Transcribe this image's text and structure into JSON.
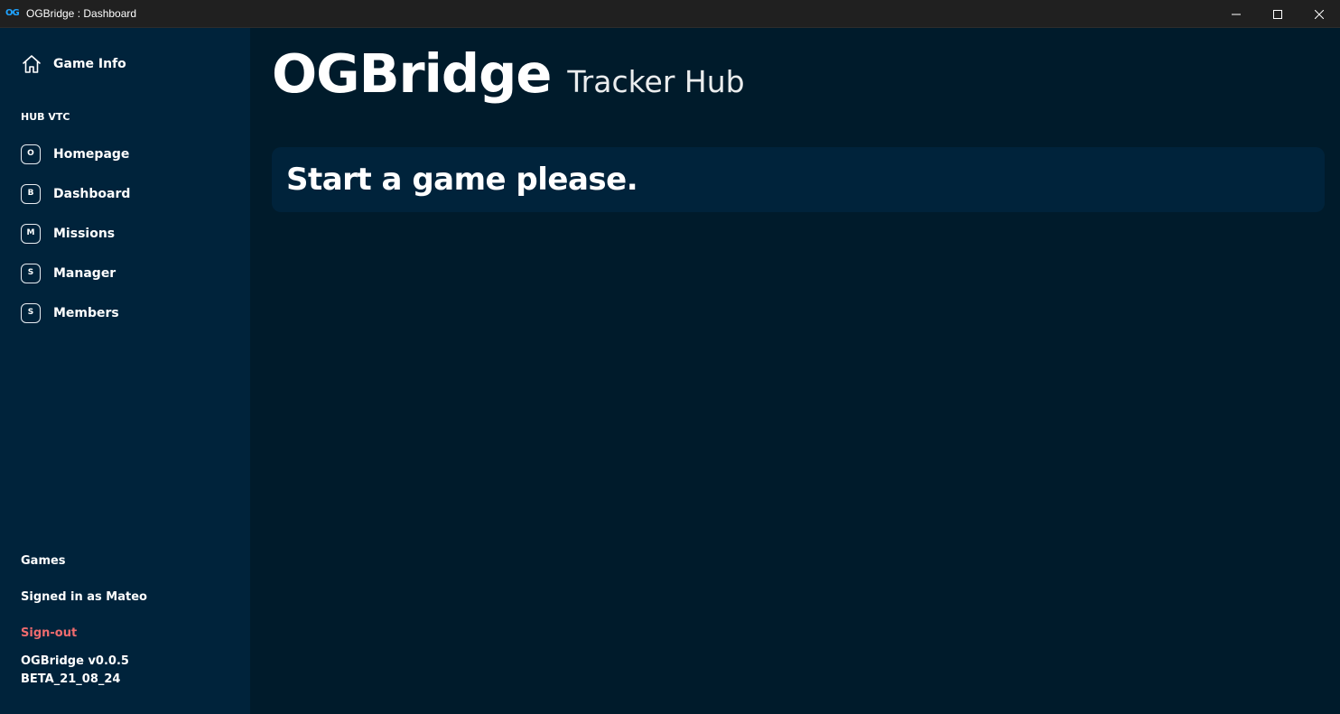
{
  "window": {
    "title": "OGBridge : Dashboard",
    "app_icon_text": "OG",
    "controls": [
      "minimize",
      "maximize",
      "close"
    ]
  },
  "sidebar": {
    "home": {
      "label": "Game Info",
      "icon": "home-icon"
    },
    "section_label": "HUB VTC",
    "items": [
      {
        "badge": "O",
        "label": "Homepage"
      },
      {
        "badge": "B",
        "label": "Dashboard"
      },
      {
        "badge": "M",
        "label": "Missions"
      },
      {
        "badge": "S",
        "label": "Manager"
      },
      {
        "badge": "S",
        "label": "Members"
      }
    ],
    "games_label": "Games",
    "signed_in_text": "Signed in as Mateo",
    "sign_out_label": "Sign-out",
    "version_line1": "OGBridge v0.0.5",
    "version_line2": "BETA_21_08_24"
  },
  "main": {
    "brand_title": "OGBridge",
    "brand_subtitle": "Tracker Hub",
    "notice_text": "Start a game please."
  },
  "colors": {
    "titlebar_bg": "#202020",
    "sidebar_bg": "#00233b",
    "main_bg": "#001b2b",
    "panel_bg": "#00233b",
    "accent_blue": "#1fa3ff",
    "sign_out_red": "#ee6b6e",
    "text": "#ffffff"
  }
}
